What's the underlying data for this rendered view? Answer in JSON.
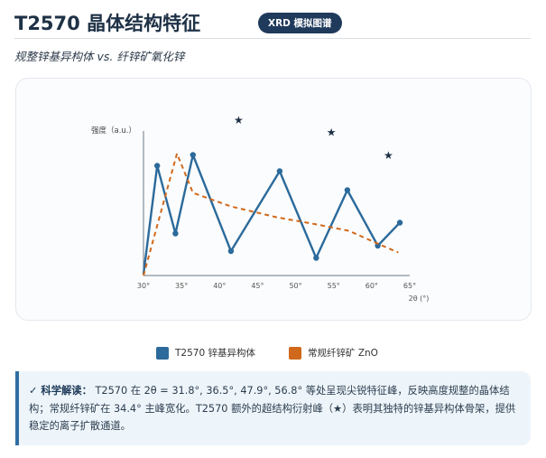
{
  "header": {
    "title": "T2570 晶体结构特征",
    "badge": "XRD 模拟图谱"
  },
  "subtitle": "规整锌基异构体 vs. 纤锌矿氧化锌",
  "chart_data": {
    "type": "line",
    "ylabel": "强度（a.u.）",
    "xlabel": "2θ (°)",
    "xlim": [
      30,
      65
    ],
    "x_ticks": [
      "30°",
      "35°",
      "40°",
      "45°",
      "50°",
      "55°",
      "60°",
      "65°"
    ],
    "y_ticks": [],
    "ylim": [
      0,
      100
    ],
    "grid": false,
    "legend_position": "bottom",
    "series": [
      {
        "name": "T2570 锌基异构体",
        "color": "#2b6a9b",
        "style": "solid",
        "markers": true,
        "x": [
          30,
          31.8,
          34.2,
          36.5,
          41.5,
          47.9,
          52.7,
          56.8,
          60.8,
          63.7
        ],
        "y": [
          1,
          81,
          31,
          89,
          18,
          77,
          13,
          63,
          22,
          39
        ]
      },
      {
        "name": "常规纤锌矿 ZnO",
        "color": "#d0691b",
        "style": "dashed",
        "markers": false,
        "x": [
          30,
          34.4,
          36.5,
          41.5,
          47.5,
          52.5,
          57.0,
          61.0,
          63.5
        ],
        "y": [
          0,
          90,
          61,
          51,
          43,
          38,
          33,
          23,
          17
        ]
      }
    ],
    "annotations": [
      {
        "symbol": "★",
        "x": 42.5,
        "y": 112
      },
      {
        "symbol": "★",
        "x": 54.7,
        "y": 103
      },
      {
        "symbol": "★",
        "x": 62.2,
        "y": 86
      }
    ]
  },
  "note": {
    "label": "✓ 科学解读：",
    "text": "T2570 在 2θ = 31.8°, 36.5°, 47.9°, 56.8° 等处呈现尖锐特征峰，反映高度规整的晶体结构；常规纤锌矿在 34.4° 主峰宽化。T2570 额外的超结构衍射峰（★）表明其独特的锌基异构体骨架，提供稳定的离子扩散通道。"
  }
}
